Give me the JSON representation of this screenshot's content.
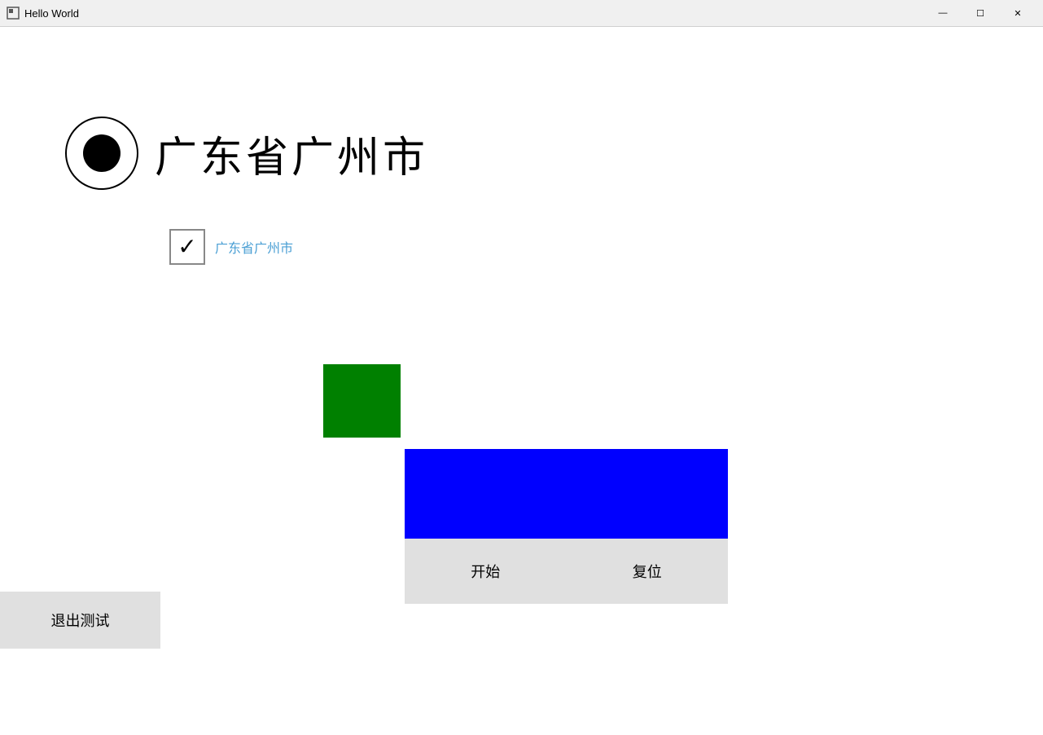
{
  "titlebar": {
    "title": "Hello World",
    "minimize_label": "—",
    "maximize_label": "☐",
    "close_label": "✕"
  },
  "radio": {
    "label": "广东省广州市"
  },
  "checkbox": {
    "tick": "✓",
    "label": "广东省广州市"
  },
  "colors": {
    "green": "#008000",
    "blue": "#0000ff",
    "blue_small": "#0000ff"
  },
  "buttons": {
    "start_label": "开始",
    "reset_label": "复位",
    "exit_label": "退出测试"
  }
}
